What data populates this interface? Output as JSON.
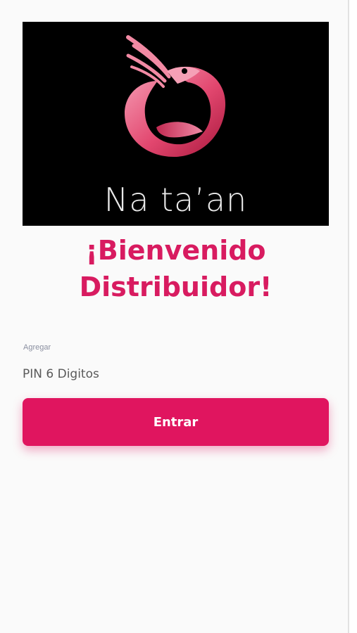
{
  "logo": {
    "icon": "shrimp-logo-icon",
    "brand_text": "Na ta’an"
  },
  "welcome": {
    "line1": "¡Bienvenido",
    "line2": "Distribuidor!"
  },
  "pin_field": {
    "label": "Agregar",
    "placeholder": "PIN 6 Digitos",
    "value": ""
  },
  "enter_button": {
    "label": "Entrar"
  },
  "colors": {
    "accent": "#e0155f",
    "heading": "#d81b60",
    "logo_background": "#000000"
  }
}
